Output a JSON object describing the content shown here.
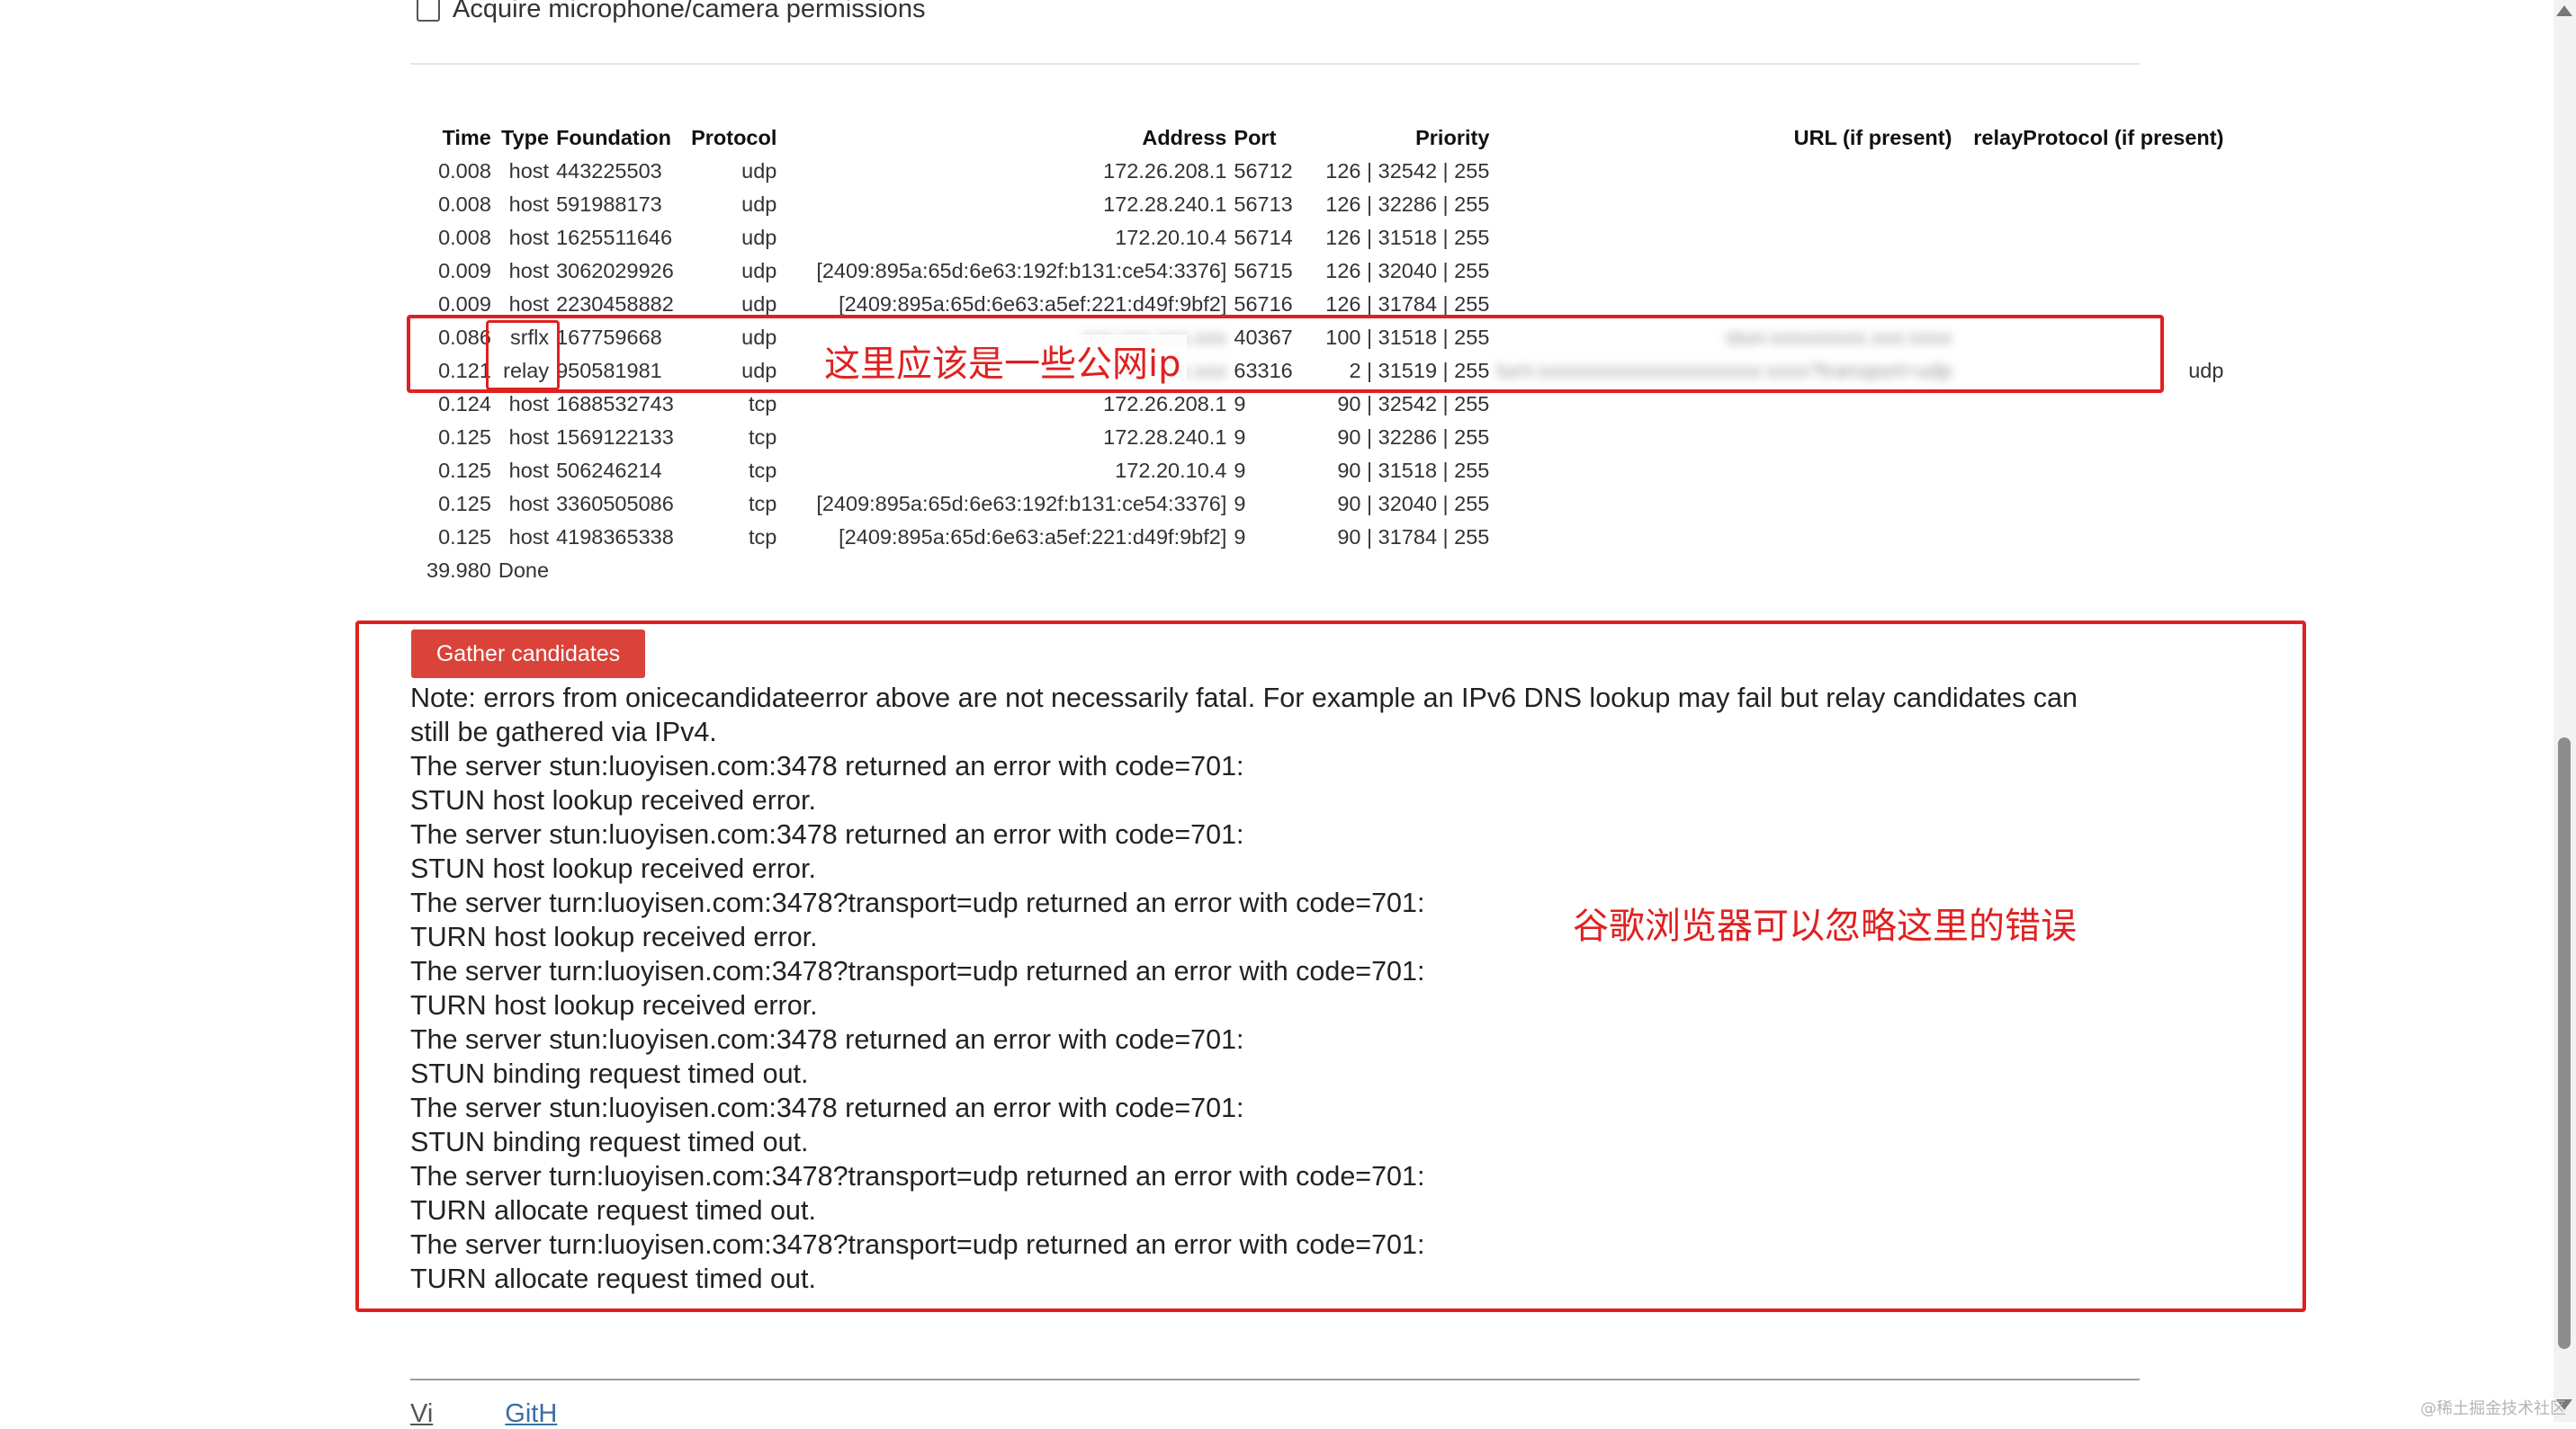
{
  "permissions": {
    "label": "Acquire microphone/camera permissions",
    "checked": false
  },
  "table": {
    "headers": [
      "Time",
      "Type",
      "Foundation",
      "Protocol",
      "Address",
      "Port",
      "Priority",
      "URL (if present)",
      "relayProtocol (if present)"
    ],
    "rows": [
      [
        "0.008",
        "host",
        "443225503",
        "udp",
        "172.26.208.1",
        "56712",
        "126 | 32542 | 255",
        "",
        ""
      ],
      [
        "0.008",
        "host",
        "591988173",
        "udp",
        "172.28.240.1",
        "56713",
        "126 | 32286 | 255",
        "",
        ""
      ],
      [
        "0.008",
        "host",
        "1625511646",
        "udp",
        "172.20.10.4",
        "56714",
        "126 | 31518 | 255",
        "",
        ""
      ],
      [
        "0.009",
        "host",
        "3062029926",
        "udp",
        "[2409:895a:65d:6e63:192f:b131:ce54:3376]",
        "56715",
        "126 | 32040 | 255",
        "",
        ""
      ],
      [
        "0.009",
        "host",
        "2230458882",
        "udp",
        "[2409:895a:65d:6e63:a5ef:221:d49f:9bf2]",
        "56716",
        "126 | 31784 | 255",
        "",
        ""
      ],
      [
        "0.086",
        "srflx",
        "167759668",
        "udp",
        "",
        "40367",
        "100 | 31518 | 255",
        "",
        ""
      ],
      [
        "0.121",
        "relay",
        "950581981",
        "udp",
        "",
        "63316",
        "2 | 31519 | 255",
        "",
        "udp"
      ],
      [
        "0.124",
        "host",
        "1688532743",
        "tcp",
        "172.26.208.1",
        "9",
        "90 | 32542 | 255",
        "",
        ""
      ],
      [
        "0.125",
        "host",
        "1569122133",
        "tcp",
        "172.28.240.1",
        "9",
        "90 | 32286 | 255",
        "",
        ""
      ],
      [
        "0.125",
        "host",
        "506246214",
        "tcp",
        "172.20.10.4",
        "9",
        "90 | 31518 | 255",
        "",
        ""
      ],
      [
        "0.125",
        "host",
        "3360505086",
        "tcp",
        "[2409:895a:65d:6e63:192f:b131:ce54:3376]",
        "9",
        "90 | 32040 | 255",
        "",
        ""
      ],
      [
        "0.125",
        "host",
        "4198365338",
        "tcp",
        "[2409:895a:65d:6e63:a5ef:221:d49f:9bf2]",
        "9",
        "90 | 31784 | 255",
        "",
        ""
      ],
      [
        "39.980",
        "Done",
        "",
        "",
        "",
        "",
        "",
        "",
        ""
      ]
    ]
  },
  "annotations": {
    "public_ip_note": "这里应该是一些公网ip",
    "chrome_note": "谷歌浏览器可以忽略这里的错误"
  },
  "gather_button": {
    "label": "Gather candidates"
  },
  "log_lines": [
    "Note: errors from onicecandidateerror above are not necessarily fatal. For example an IPv6 DNS lookup may fail but relay candidates can",
    "still be gathered via IPv4.",
    "The server stun:luoyisen.com:3478 returned an error with code=701:",
    "STUN host lookup received error.",
    "The server stun:luoyisen.com:3478 returned an error with code=701:",
    "STUN host lookup received error.",
    "The server turn:luoyisen.com:3478?transport=udp returned an error with code=701:",
    "TURN host lookup received error.",
    "The server turn:luoyisen.com:3478?transport=udp returned an error with code=701:",
    "TURN host lookup received error.",
    "The server stun:luoyisen.com:3478 returned an error with code=701:",
    "STUN binding request timed out.",
    "The server stun:luoyisen.com:3478 returned an error with code=701:",
    "STUN binding request timed out.",
    "The server turn:luoyisen.com:3478?transport=udp returned an error with code=701:",
    "TURN allocate request timed out.",
    "The server turn:luoyisen.com:3478?transport=udp returned an error with code=701:",
    "TURN allocate request timed out."
  ],
  "footer": {
    "link1": "Vi",
    "link2": "GitH"
  },
  "watermark": "@稀土掘金技术社区",
  "colors": {
    "annotation_red": "#e02020",
    "button_red": "#d9433a"
  }
}
